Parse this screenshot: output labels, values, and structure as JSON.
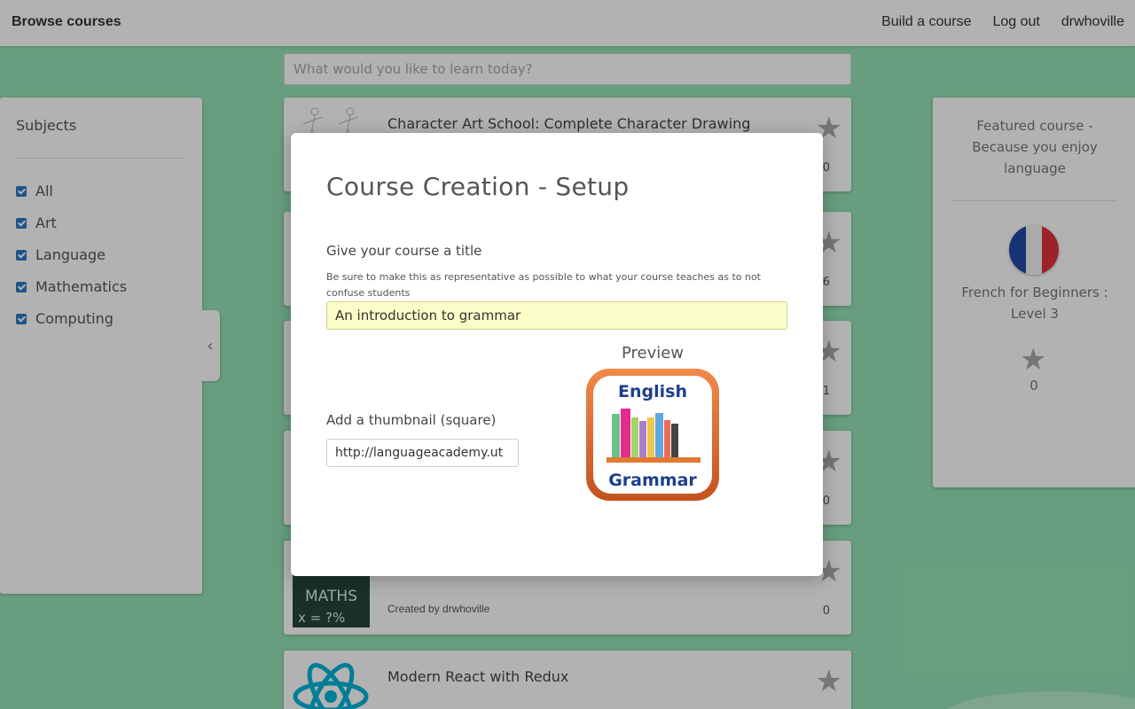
{
  "header": {
    "brand": "Browse courses",
    "nav": [
      "Build a course",
      "Log out",
      "drwhoville"
    ]
  },
  "search": {
    "placeholder": "What would you like to learn today?"
  },
  "subjects": {
    "title": "Subjects",
    "items": [
      {
        "label": "All",
        "checked": true
      },
      {
        "label": "Art",
        "checked": true
      },
      {
        "label": "Language",
        "checked": true
      },
      {
        "label": "Mathematics",
        "checked": true
      },
      {
        "label": "Computing",
        "checked": true
      }
    ]
  },
  "courses": [
    {
      "title": "Character Art School: Complete Character Drawing",
      "creator": "",
      "count": "0"
    },
    {
      "title": "",
      "creator": "",
      "count": "6"
    },
    {
      "title": "",
      "creator": "",
      "count": "1"
    },
    {
      "title": "",
      "creator": "",
      "count": "0"
    },
    {
      "title": "",
      "creator": "Created by drwhoville",
      "count": "0",
      "thumb_text": [
        "MATHS",
        "x = ?%"
      ]
    },
    {
      "title": "Modern React with Redux",
      "creator": "",
      "count": ""
    }
  ],
  "featured": {
    "heading": "Featured course - Because you enjoy language",
    "name": "French for Beginners : Level 3",
    "count": "0"
  },
  "modal": {
    "title": "Course Creation - Setup",
    "title_label": "Give your course a title",
    "title_hint": "Be sure to make this as representative as possible to what your course teaches as to not confuse students",
    "title_value": "An introduction to grammar",
    "thumb_label": "Add a thumbnail (square)",
    "thumb_value": "http://languageacademy.ut",
    "preview_label": "Preview",
    "preview_words": [
      "English",
      "Grammar"
    ]
  },
  "colors": {
    "background": "#96e3b6",
    "checkbox": "#2f78c4",
    "title_input_bg": "#fbfdc8",
    "preview_frame": "#d9652b"
  },
  "icons": [
    "star-icon",
    "chevron-left-icon",
    "checkbox-icon",
    "french-flag-icon",
    "react-logo-icon"
  ]
}
